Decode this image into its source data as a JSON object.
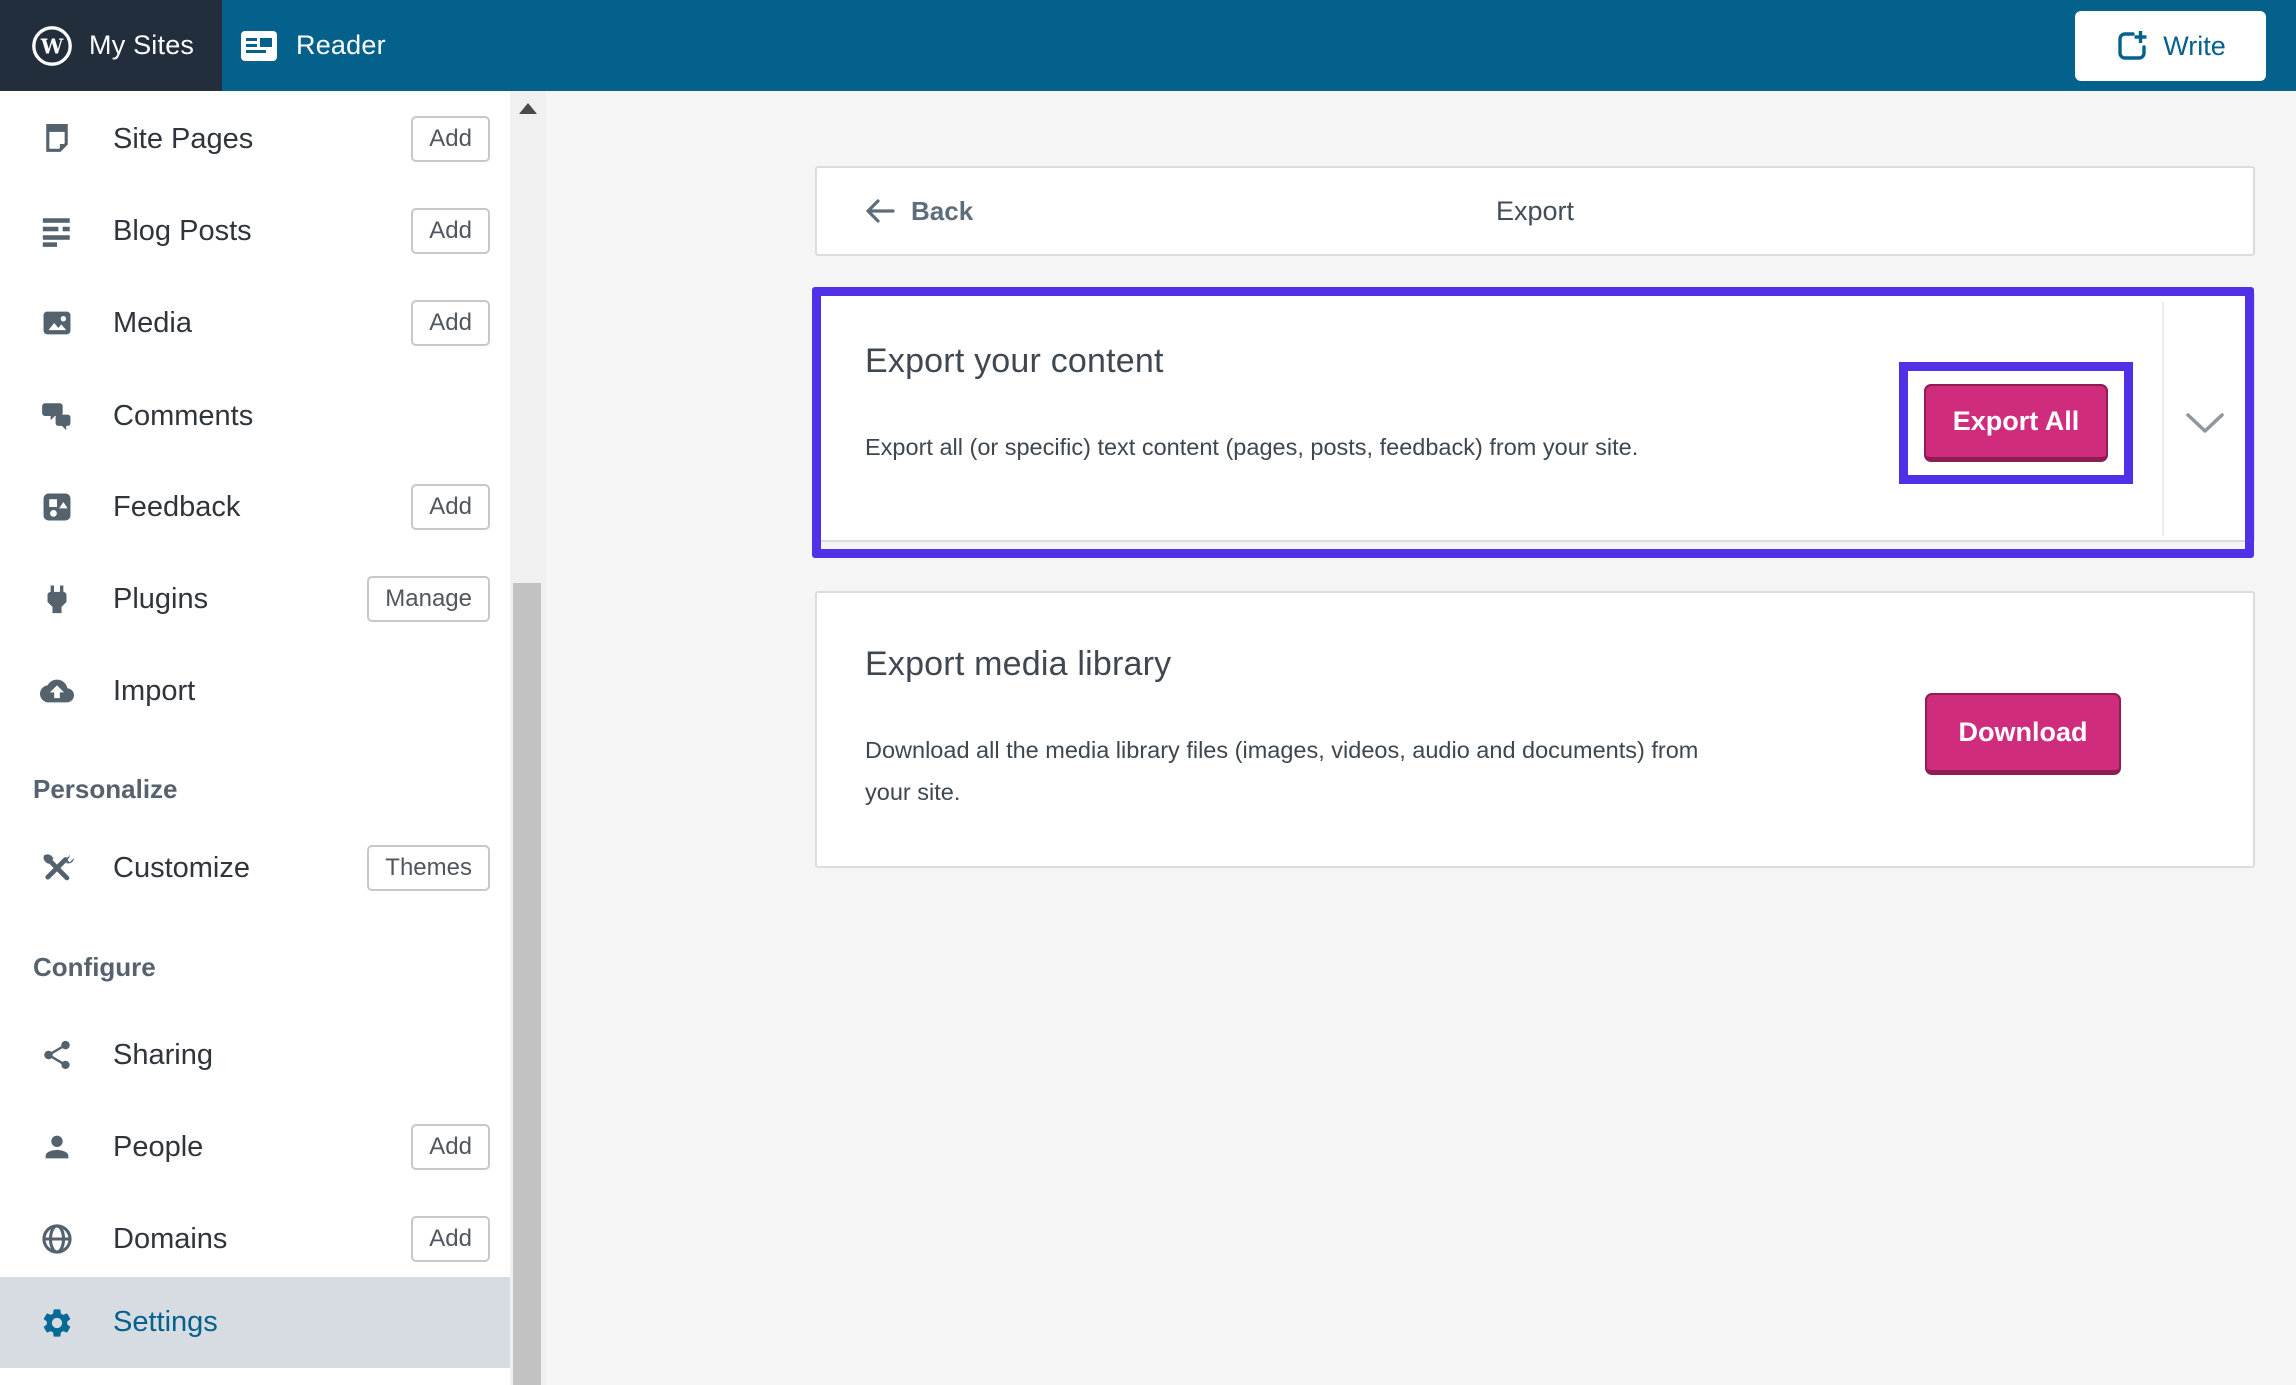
{
  "masterbar": {
    "my_sites_label": "My Sites",
    "reader_label": "Reader",
    "write_label": "Write"
  },
  "sidebar": {
    "items": [
      {
        "label": "Site Pages",
        "action": "Add",
        "icon": "page-icon"
      },
      {
        "label": "Blog Posts",
        "action": "Add",
        "icon": "posts-icon"
      },
      {
        "label": "Media",
        "action": "Add",
        "icon": "media-icon"
      },
      {
        "label": "Comments",
        "action": "",
        "icon": "comments-icon"
      },
      {
        "label": "Feedback",
        "action": "Add",
        "icon": "feedback-icon"
      },
      {
        "label": "Plugins",
        "action": "Manage",
        "icon": "plugin-icon"
      },
      {
        "label": "Import",
        "action": "",
        "icon": "import-icon"
      },
      {
        "label": "Customize",
        "action": "Themes",
        "icon": "customize-icon"
      },
      {
        "label": "Sharing",
        "action": "",
        "icon": "sharing-icon"
      },
      {
        "label": "People",
        "action": "Add",
        "icon": "people-icon"
      },
      {
        "label": "Domains",
        "action": "Add",
        "icon": "domains-icon"
      },
      {
        "label": "Settings",
        "action": "",
        "icon": "gear-icon",
        "selected": true
      }
    ],
    "sections": [
      {
        "label": "Personalize"
      },
      {
        "label": "Configure"
      }
    ]
  },
  "content": {
    "header": {
      "back_label": "Back",
      "title": "Export"
    },
    "export_content_card": {
      "title": "Export your content",
      "description": "Export all (or specific) text content (pages, posts, feedback) from your site.",
      "button_label": "Export All"
    },
    "export_media_card": {
      "title": "Export media library",
      "description": "Download all the media library files (images, videos, audio and documents) from your site.",
      "button_label": "Download"
    }
  },
  "colors": {
    "masterbar_teal": "#04618C",
    "masterbar_dark": "#232E3D",
    "accent_pink": "#D02C7D",
    "accent_pink_border": "#8E1D52",
    "highlight_purple": "#5130E8",
    "selected_item_bg": "#D6DCE2",
    "sidebar_icon_gray": "#54626E"
  }
}
